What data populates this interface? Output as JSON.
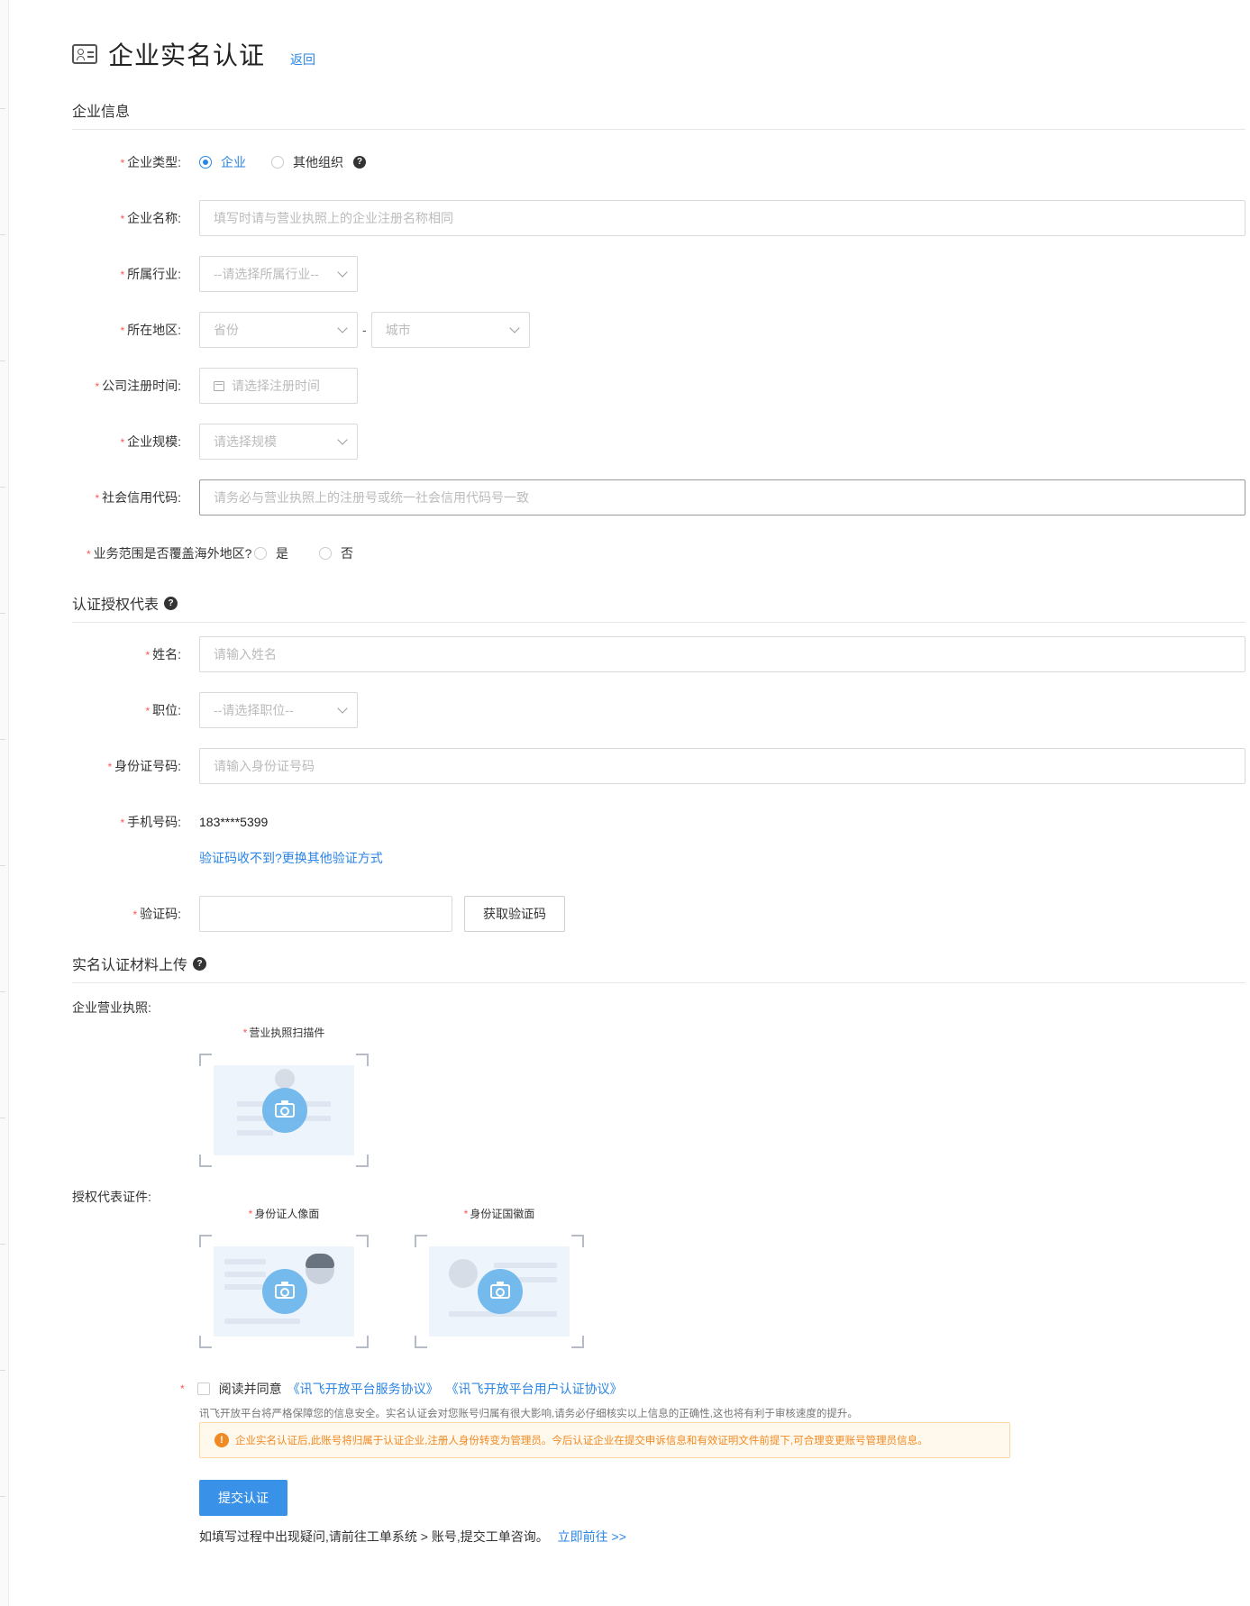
{
  "header": {
    "title": "企业实名认证",
    "back": "返回"
  },
  "sections": {
    "company": "企业信息",
    "representative": "认证授权代表",
    "materials": "实名认证材料上传"
  },
  "company": {
    "type": {
      "label": "企业类型:",
      "options": [
        "企业",
        "其他组织"
      ],
      "selected": "企业"
    },
    "name": {
      "label": "企业名称:",
      "placeholder": "填写时请与营业执照上的企业注册名称相同"
    },
    "industry": {
      "label": "所属行业:",
      "placeholder": "--请选择所属行业--"
    },
    "region": {
      "label": "所在地区:",
      "province": "省份",
      "city": "城市",
      "separator": "-"
    },
    "reg_time": {
      "label": "公司注册时间:",
      "placeholder": "请选择注册时间"
    },
    "scale": {
      "label": "企业规模:",
      "placeholder": "请选择规模"
    },
    "credit_code": {
      "label": "社会信用代码:",
      "placeholder": "请务必与营业执照上的注册号或统一社会信用代码号一致"
    },
    "overseas": {
      "label": "业务范围是否覆盖海外地区?",
      "options": [
        "是",
        "否"
      ]
    }
  },
  "representative": {
    "name": {
      "label": "姓名:",
      "placeholder": "请输入姓名"
    },
    "position": {
      "label": "职位:",
      "placeholder": "--请选择职位--"
    },
    "id_number": {
      "label": "身份证号码:",
      "placeholder": "请输入身份证号码"
    },
    "phone": {
      "label": "手机号码:",
      "value": "183****5399"
    },
    "alt_verify": "验证码收不到?更换其他验证方式",
    "code": {
      "label": "验证码:",
      "value": "",
      "button": "获取验证码"
    }
  },
  "materials": {
    "license_label": "企业营业执照:",
    "license_upload": "营业执照扫描件",
    "rep_label": "授权代表证件:",
    "id_front": "身份证人像面",
    "id_back": "身份证国徽面"
  },
  "agreement": {
    "prefix": "阅读并同意",
    "link1": "《讯飞开放平台服务协议》",
    "link2": "《讯飞开放平台用户认证协议》",
    "note": "讯飞开放平台将严格保障您的信息安全。实名认证会对您账号归属有很大影响,请务必仔细核实以上信息的正确性,这也将有利于审核速度的提升。",
    "warning": "企业实名认证后,此账号将归属于认证企业,注册人身份转变为管理员。今后认证企业在提交申诉信息和有效证明文件前提下,可合理变更账号管理员信息。"
  },
  "submit": "提交认证",
  "help": {
    "text": "如填写过程中出现疑问,请前往工单系统 > 账号,提交工单咨询。",
    "link": "立即前往 >>"
  },
  "colors": {
    "accent": "#2b85e4",
    "required": "#ff5555",
    "warning": "#f08a24",
    "primary_button": "#3a91e8"
  }
}
